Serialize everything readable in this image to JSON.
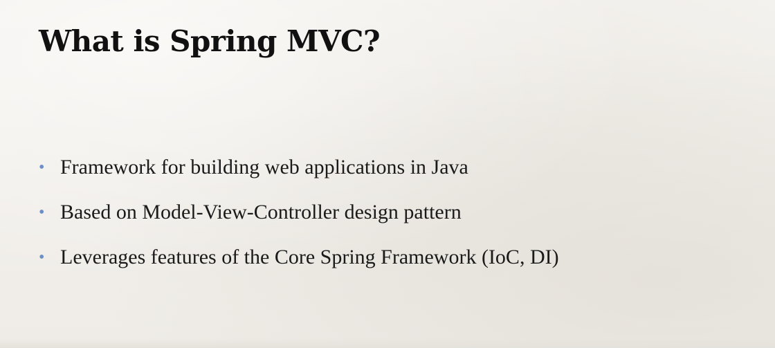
{
  "slide": {
    "title": "What is Spring MVC?",
    "bullets": [
      "Framework for building web applications in Java",
      "Based on Model-View-Controller design pattern",
      "Leverages features of the Core Spring Framework (IoC, DI)"
    ],
    "bullet_marker": "•",
    "colors": {
      "background": "#f2f0ec",
      "title": "#111111",
      "text": "#1a1a1a",
      "bullet": "#6d8fc6"
    }
  }
}
